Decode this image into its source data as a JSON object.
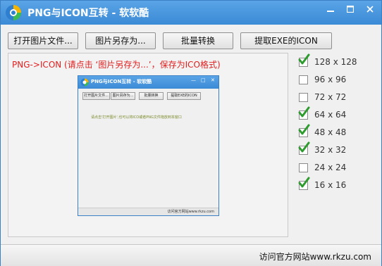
{
  "window": {
    "title": "PNG与ICON互转 - 软软酷",
    "controls": {
      "minimize": "—",
      "maximize": "□",
      "close": "✕"
    }
  },
  "toolbar": {
    "open_label": "打开图片文件...",
    "save_as_label": "图片另存为...",
    "batch_label": "批量转换",
    "extract_label": "提取EXE的ICON"
  },
  "main": {
    "hint": "PNG->ICON (请点击 ‘图片另存为...’，保存为ICO格式)"
  },
  "preview": {
    "title": "PNG与ICON互转 - 软软酷",
    "buttons": [
      "打开图片文件...",
      "图片另存为...",
      "批量转换",
      "提取EXE的ICON"
    ],
    "message": "请点击'打开图片',也可以将ICO或者PNG文件拖放到本窗口",
    "status": "访问官方网站www.rkzu.com"
  },
  "sizes": [
    {
      "label": "128 x 128",
      "checked": true
    },
    {
      "label": "96 x 96",
      "checked": false
    },
    {
      "label": "72 x 72",
      "checked": false
    },
    {
      "label": "64 x 64",
      "checked": true
    },
    {
      "label": "48 x 48",
      "checked": true
    },
    {
      "label": "32 x 32",
      "checked": true
    },
    {
      "label": "24 x 24",
      "checked": false
    },
    {
      "label": "16 x 16",
      "checked": true
    }
  ],
  "statusbar": {
    "link": "访问官方网站www.rkzu.com"
  },
  "colors": {
    "accent": "#3b8ad6",
    "hint": "#e02020",
    "check": "#2e9b2e"
  }
}
